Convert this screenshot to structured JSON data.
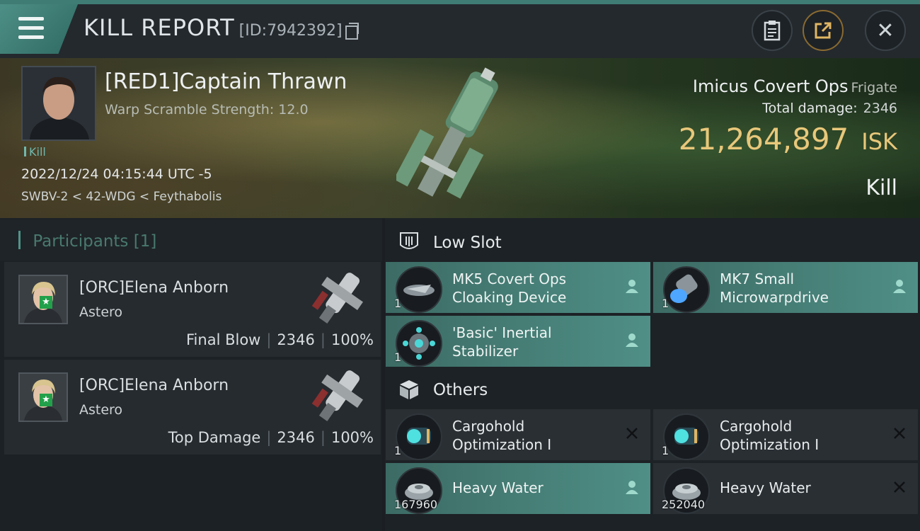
{
  "header": {
    "title": "KILL REPORT",
    "report_id": "[ID:7942392]"
  },
  "victim": {
    "name": "[RED1]Captain Thrawn",
    "warp_scramble": "Warp Scramble Strength: 12.0",
    "kill_tag": "Kill",
    "datetime": "2022/12/24 04:15:44 UTC -5",
    "location": "SWBV-2 < 42-WDG < Feythabolis",
    "ship": "Imicus Covert Ops",
    "ship_class": "Frigate",
    "total_damage_label": "Total damage:",
    "total_damage": "2346",
    "isk_value": "21,264,897",
    "isk_unit": "ISK",
    "result": "Kill"
  },
  "participants": {
    "title": "Participants",
    "count": "[1]",
    "rows": [
      {
        "name": "[ORC]Elena Anborn",
        "ship": "Astero",
        "role": "Final Blow",
        "damage": "2346",
        "percent": "100%"
      },
      {
        "name": "[ORC]Elena Anborn",
        "ship": "Astero",
        "role": "Top Damage",
        "damage": "2346",
        "percent": "100%"
      }
    ]
  },
  "fitting": {
    "low_slot_label": "Low Slot",
    "others_label": "Others",
    "low_slot": [
      {
        "name_line1": "MK5 Covert Ops",
        "name_line2": "Cloaking Device",
        "qty": "1",
        "status": "person-icon"
      },
      {
        "name_line1": "MK7 Small",
        "name_line2": "Microwarpdrive",
        "qty": "1",
        "status": "person-icon"
      },
      {
        "name_line1": "'Basic' Inertial",
        "name_line2": "Stabilizer",
        "qty": "1",
        "status": "person-icon"
      }
    ],
    "others": [
      {
        "name_line1": "Cargohold",
        "name_line2": "Optimization I",
        "qty": "1",
        "status": "x-icon"
      },
      {
        "name_line1": "Cargohold",
        "name_line2": "Optimization I",
        "qty": "1",
        "status": "x-icon"
      },
      {
        "name_line1": "Heavy Water",
        "name_line2": "",
        "qty": "167960",
        "status": "person-icon"
      },
      {
        "name_line1": "Heavy Water",
        "name_line2": "",
        "qty": "252040",
        "status": "x-icon"
      }
    ]
  },
  "colors": {
    "accent_teal": "#4f8f86",
    "isk_gold": "#e8c77a",
    "background": "#1b1f24"
  }
}
